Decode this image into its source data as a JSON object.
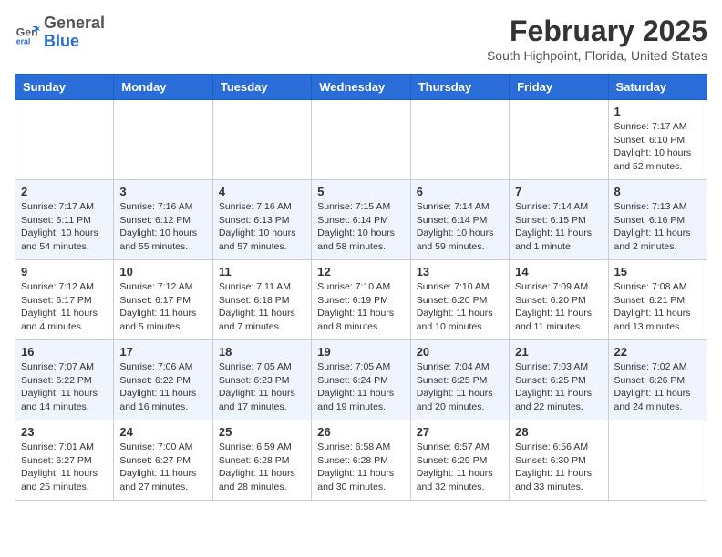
{
  "logo": {
    "general": "General",
    "blue": "Blue"
  },
  "header": {
    "month": "February 2025",
    "location": "South Highpoint, Florida, United States"
  },
  "weekdays": [
    "Sunday",
    "Monday",
    "Tuesday",
    "Wednesday",
    "Thursday",
    "Friday",
    "Saturday"
  ],
  "weeks": [
    [
      {
        "day": "",
        "info": ""
      },
      {
        "day": "",
        "info": ""
      },
      {
        "day": "",
        "info": ""
      },
      {
        "day": "",
        "info": ""
      },
      {
        "day": "",
        "info": ""
      },
      {
        "day": "",
        "info": ""
      },
      {
        "day": "1",
        "info": "Sunrise: 7:17 AM\nSunset: 6:10 PM\nDaylight: 10 hours\nand 52 minutes."
      }
    ],
    [
      {
        "day": "2",
        "info": "Sunrise: 7:17 AM\nSunset: 6:11 PM\nDaylight: 10 hours\nand 54 minutes."
      },
      {
        "day": "3",
        "info": "Sunrise: 7:16 AM\nSunset: 6:12 PM\nDaylight: 10 hours\nand 55 minutes."
      },
      {
        "day": "4",
        "info": "Sunrise: 7:16 AM\nSunset: 6:13 PM\nDaylight: 10 hours\nand 57 minutes."
      },
      {
        "day": "5",
        "info": "Sunrise: 7:15 AM\nSunset: 6:14 PM\nDaylight: 10 hours\nand 58 minutes."
      },
      {
        "day": "6",
        "info": "Sunrise: 7:14 AM\nSunset: 6:14 PM\nDaylight: 10 hours\nand 59 minutes."
      },
      {
        "day": "7",
        "info": "Sunrise: 7:14 AM\nSunset: 6:15 PM\nDaylight: 11 hours\nand 1 minute."
      },
      {
        "day": "8",
        "info": "Sunrise: 7:13 AM\nSunset: 6:16 PM\nDaylight: 11 hours\nand 2 minutes."
      }
    ],
    [
      {
        "day": "9",
        "info": "Sunrise: 7:12 AM\nSunset: 6:17 PM\nDaylight: 11 hours\nand 4 minutes."
      },
      {
        "day": "10",
        "info": "Sunrise: 7:12 AM\nSunset: 6:17 PM\nDaylight: 11 hours\nand 5 minutes."
      },
      {
        "day": "11",
        "info": "Sunrise: 7:11 AM\nSunset: 6:18 PM\nDaylight: 11 hours\nand 7 minutes."
      },
      {
        "day": "12",
        "info": "Sunrise: 7:10 AM\nSunset: 6:19 PM\nDaylight: 11 hours\nand 8 minutes."
      },
      {
        "day": "13",
        "info": "Sunrise: 7:10 AM\nSunset: 6:20 PM\nDaylight: 11 hours\nand 10 minutes."
      },
      {
        "day": "14",
        "info": "Sunrise: 7:09 AM\nSunset: 6:20 PM\nDaylight: 11 hours\nand 11 minutes."
      },
      {
        "day": "15",
        "info": "Sunrise: 7:08 AM\nSunset: 6:21 PM\nDaylight: 11 hours\nand 13 minutes."
      }
    ],
    [
      {
        "day": "16",
        "info": "Sunrise: 7:07 AM\nSunset: 6:22 PM\nDaylight: 11 hours\nand 14 minutes."
      },
      {
        "day": "17",
        "info": "Sunrise: 7:06 AM\nSunset: 6:22 PM\nDaylight: 11 hours\nand 16 minutes."
      },
      {
        "day": "18",
        "info": "Sunrise: 7:05 AM\nSunset: 6:23 PM\nDaylight: 11 hours\nand 17 minutes."
      },
      {
        "day": "19",
        "info": "Sunrise: 7:05 AM\nSunset: 6:24 PM\nDaylight: 11 hours\nand 19 minutes."
      },
      {
        "day": "20",
        "info": "Sunrise: 7:04 AM\nSunset: 6:25 PM\nDaylight: 11 hours\nand 20 minutes."
      },
      {
        "day": "21",
        "info": "Sunrise: 7:03 AM\nSunset: 6:25 PM\nDaylight: 11 hours\nand 22 minutes."
      },
      {
        "day": "22",
        "info": "Sunrise: 7:02 AM\nSunset: 6:26 PM\nDaylight: 11 hours\nand 24 minutes."
      }
    ],
    [
      {
        "day": "23",
        "info": "Sunrise: 7:01 AM\nSunset: 6:27 PM\nDaylight: 11 hours\nand 25 minutes."
      },
      {
        "day": "24",
        "info": "Sunrise: 7:00 AM\nSunset: 6:27 PM\nDaylight: 11 hours\nand 27 minutes."
      },
      {
        "day": "25",
        "info": "Sunrise: 6:59 AM\nSunset: 6:28 PM\nDaylight: 11 hours\nand 28 minutes."
      },
      {
        "day": "26",
        "info": "Sunrise: 6:58 AM\nSunset: 6:28 PM\nDaylight: 11 hours\nand 30 minutes."
      },
      {
        "day": "27",
        "info": "Sunrise: 6:57 AM\nSunset: 6:29 PM\nDaylight: 11 hours\nand 32 minutes."
      },
      {
        "day": "28",
        "info": "Sunrise: 6:56 AM\nSunset: 6:30 PM\nDaylight: 11 hours\nand 33 minutes."
      },
      {
        "day": "",
        "info": ""
      }
    ]
  ]
}
